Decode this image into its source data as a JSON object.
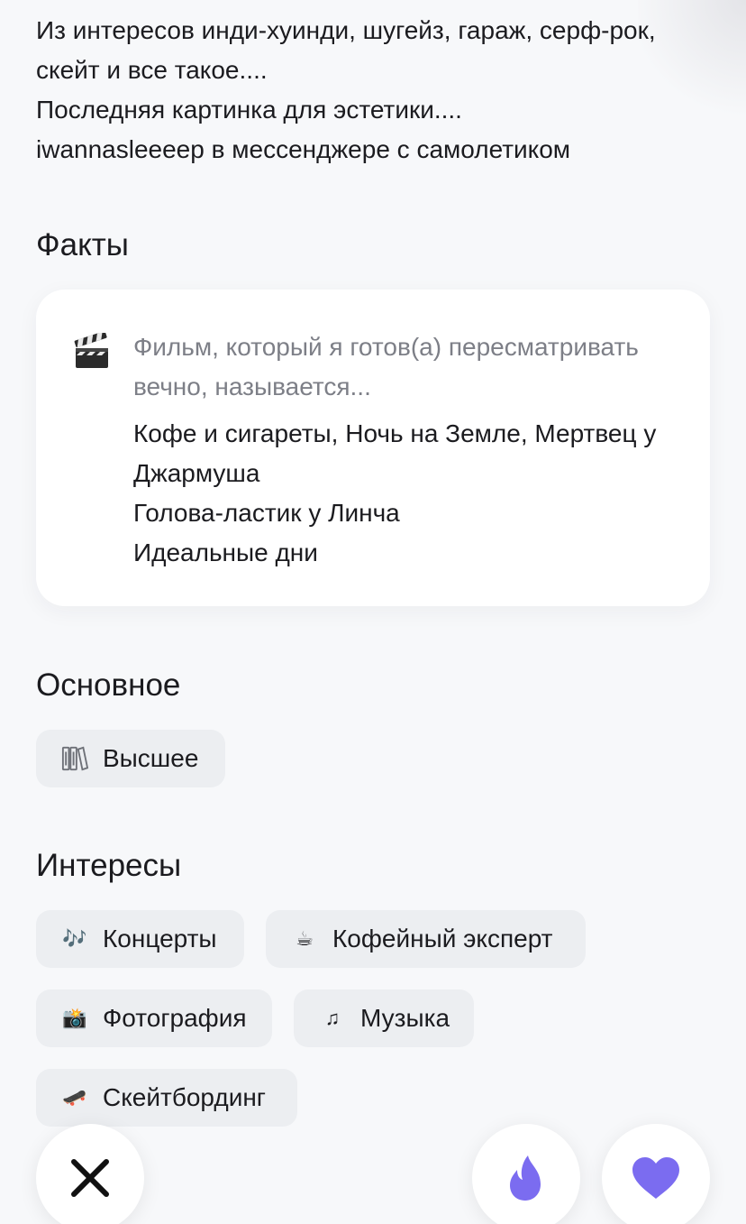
{
  "bio": {
    "lines": [
      "Из интересов инди-хуинди, шугейз, гараж, серф-рок,",
      "скейт и все такое....",
      "Последняя картинка для эстетики....",
      "iwannasleeeep в мессенджере с самолетиком"
    ]
  },
  "facts": {
    "title": "Факты",
    "card": {
      "icon": "clapperboard-icon",
      "question": "Фильм, который я готов(а) пересматривать вечно, называется...",
      "answer_lines": [
        "Кофе и сигареты, Ночь на Земле, Мертвец у",
        "Джармуша",
        "Голова-ластик у Линча",
        "Идеальные дни"
      ]
    }
  },
  "basics": {
    "title": "Основное",
    "education": {
      "label": "Высшее",
      "icon": "books-icon"
    }
  },
  "interests": {
    "title": "Интересы",
    "items": [
      {
        "label": "Концерты",
        "icon": "music-notes-icon",
        "glyph": "🎶"
      },
      {
        "label": "Кофейный эксперт",
        "icon": "coffee-icon",
        "glyph": "☕"
      },
      {
        "label": "Фотография",
        "icon": "camera-flash-icon",
        "glyph": "📸"
      },
      {
        "label": "Музыка",
        "icon": "music-note-icon",
        "glyph": "♫"
      },
      {
        "label": "Скейтбординг",
        "icon": "skateboard-icon",
        "glyph": "🛹"
      }
    ]
  },
  "actions": {
    "dislike_icon": "close-icon",
    "superlike_icon": "flame-icon",
    "like_icon": "heart-icon",
    "accent_color": "#7b6cf0"
  }
}
